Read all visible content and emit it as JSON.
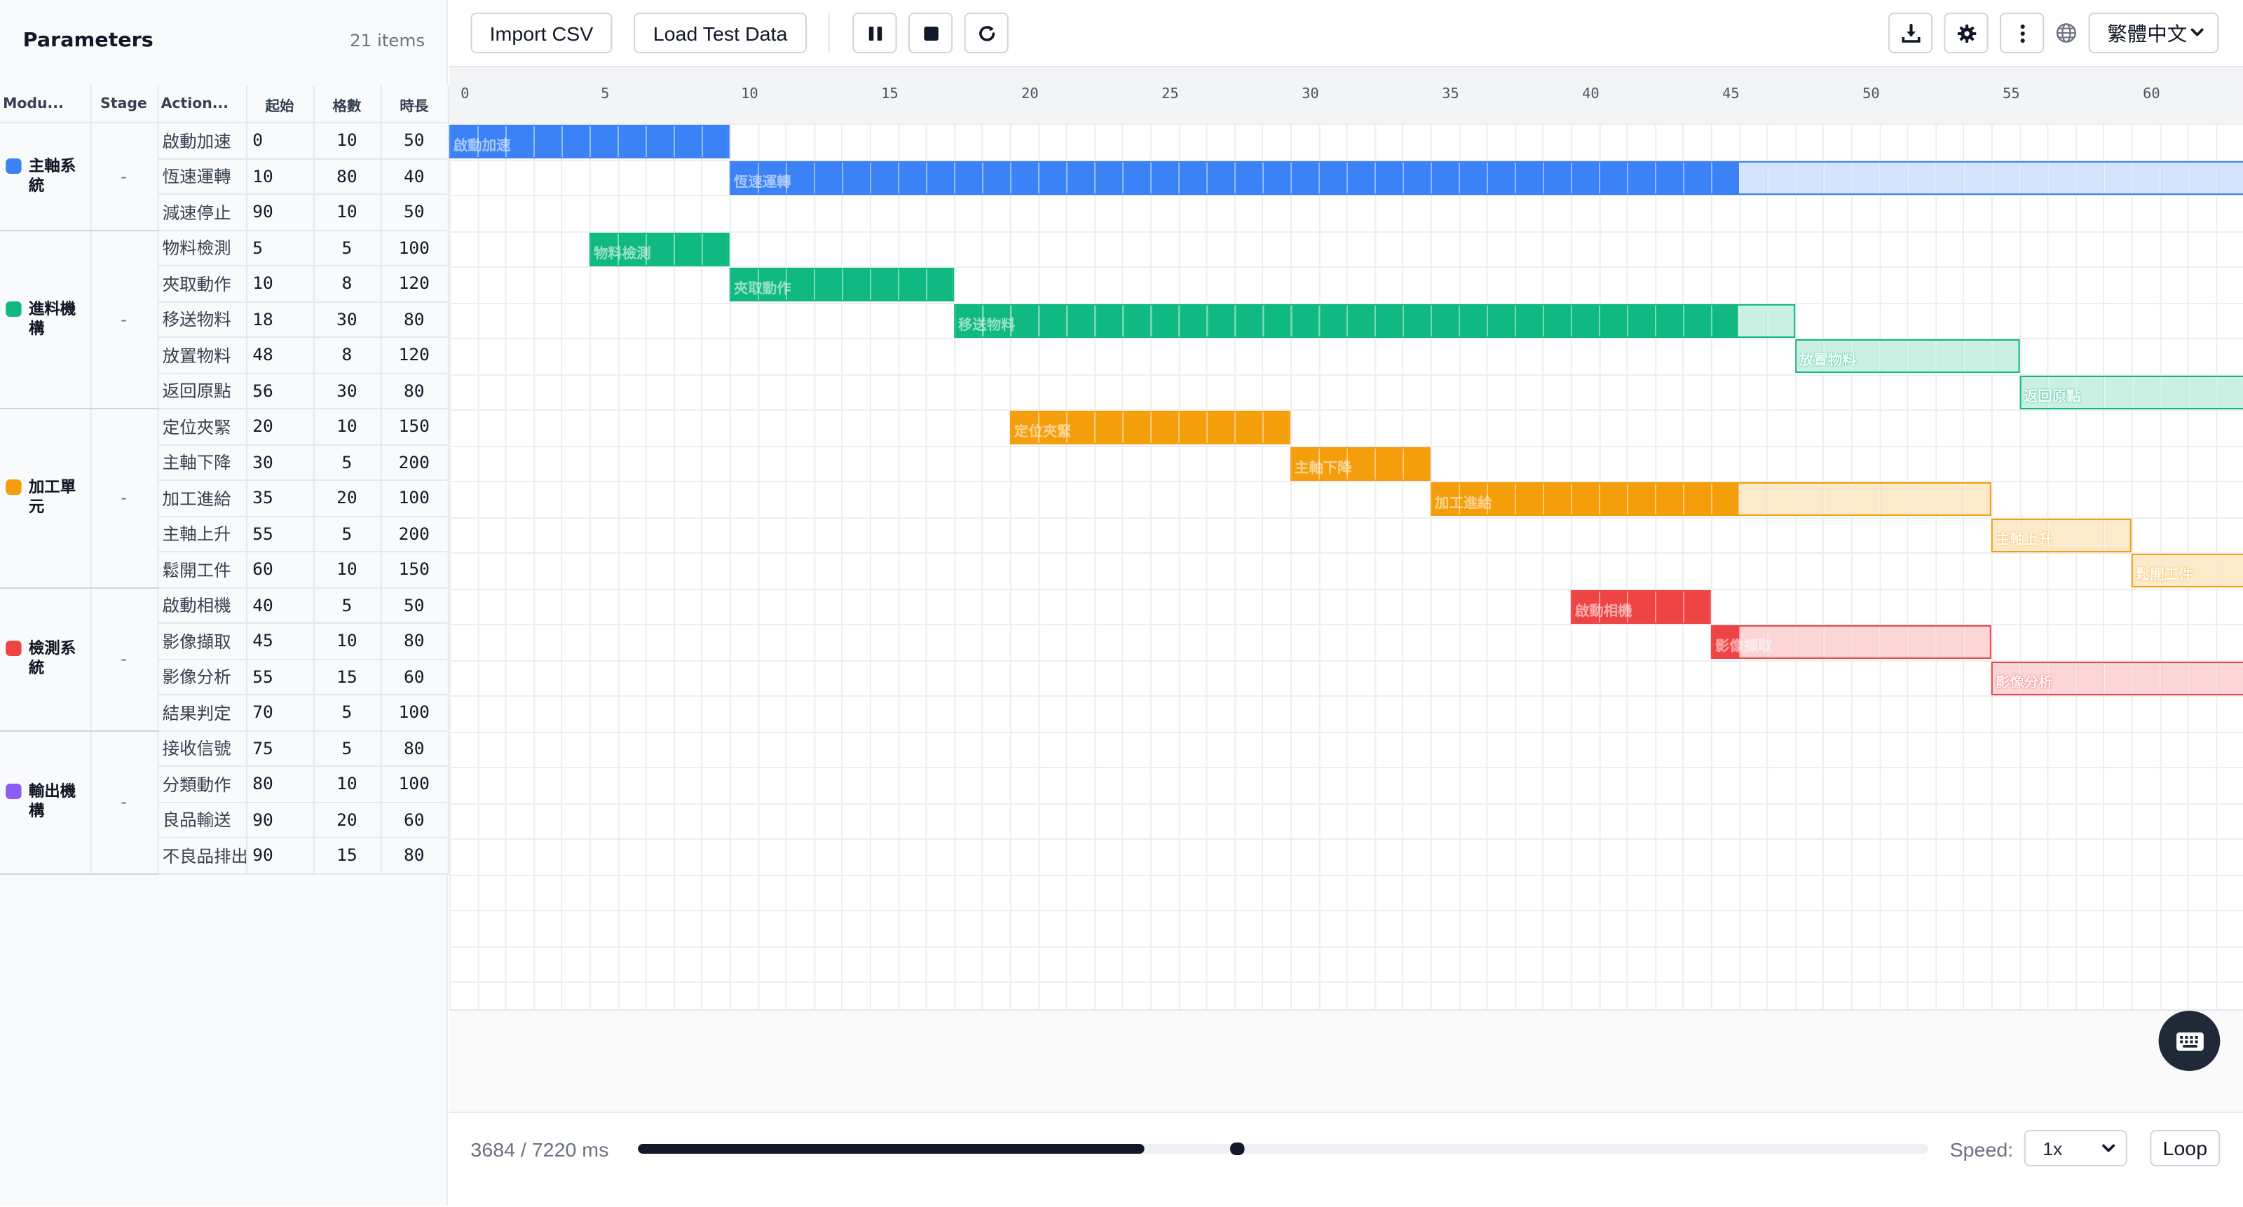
{
  "panel": {
    "title": "Parameters",
    "count": "21 items"
  },
  "table": {
    "headers": {
      "module": "Modu...",
      "stage": "Stage",
      "action": "Action...",
      "start": "起始",
      "cells": "格數",
      "duration": "時長"
    },
    "modules": [
      {
        "name": "主軸系統",
        "color": "#3b82f6",
        "stage": "-",
        "actions": [
          {
            "name": "啟動加速",
            "start": "0",
            "cells": "10",
            "duration": "50"
          },
          {
            "name": "恆速運轉",
            "start": "10",
            "cells": "80",
            "duration": "40"
          },
          {
            "name": "減速停止",
            "start": "90",
            "cells": "10",
            "duration": "50"
          }
        ]
      },
      {
        "name": "進料機構",
        "color": "#10b981",
        "stage": "-",
        "actions": [
          {
            "name": "物料檢測",
            "start": "5",
            "cells": "5",
            "duration": "100"
          },
          {
            "name": "夾取動作",
            "start": "10",
            "cells": "8",
            "duration": "120"
          },
          {
            "name": "移送物料",
            "start": "18",
            "cells": "30",
            "duration": "80"
          },
          {
            "name": "放置物料",
            "start": "48",
            "cells": "8",
            "duration": "120"
          },
          {
            "name": "返回原點",
            "start": "56",
            "cells": "30",
            "duration": "80"
          }
        ]
      },
      {
        "name": "加工單元",
        "color": "#f59e0b",
        "stage": "-",
        "actions": [
          {
            "name": "定位夾緊",
            "start": "20",
            "cells": "10",
            "duration": "150"
          },
          {
            "name": "主軸下降",
            "start": "30",
            "cells": "5",
            "duration": "200"
          },
          {
            "name": "加工進給",
            "start": "35",
            "cells": "20",
            "duration": "100"
          },
          {
            "name": "主軸上升",
            "start": "55",
            "cells": "5",
            "duration": "200"
          },
          {
            "name": "鬆開工件",
            "start": "60",
            "cells": "10",
            "duration": "150"
          }
        ]
      },
      {
        "name": "檢測系統",
        "color": "#ef4444",
        "stage": "-",
        "actions": [
          {
            "name": "啟動相機",
            "start": "40",
            "cells": "5",
            "duration": "50"
          },
          {
            "name": "影像擷取",
            "start": "45",
            "cells": "10",
            "duration": "80"
          },
          {
            "name": "影像分析",
            "start": "55",
            "cells": "15",
            "duration": "60"
          },
          {
            "name": "結果判定",
            "start": "70",
            "cells": "5",
            "duration": "100"
          }
        ]
      },
      {
        "name": "輸出機構",
        "color": "#8b5cf6",
        "stage": "-",
        "actions": [
          {
            "name": "接收信號",
            "start": "75",
            "cells": "5",
            "duration": "80"
          },
          {
            "name": "分類動作",
            "start": "80",
            "cells": "10",
            "duration": "100"
          },
          {
            "name": "良品輸送",
            "start": "90",
            "cells": "20",
            "duration": "60"
          },
          {
            "name": "不良品排出",
            "start": "90",
            "cells": "15",
            "duration": "80"
          }
        ]
      }
    ]
  },
  "toolbar": {
    "import_label": "Import CSV",
    "load_label": "Load Test Data",
    "language": "繁體中文",
    "icons": [
      "pause-icon",
      "stop-icon",
      "restart-icon",
      "download-icon",
      "gear-icon",
      "more-vertical-icon",
      "globe-icon"
    ]
  },
  "timeline": {
    "ruler_labels": [
      "0",
      "5",
      "10",
      "15",
      "20",
      "25",
      "30",
      "35",
      "40",
      "45",
      "50",
      "55",
      "60"
    ],
    "visible_units": 64,
    "row_count": 24,
    "playhead_unit": 46,
    "bars": [
      {
        "row": 0,
        "start": 0,
        "cells": 10,
        "label": "啟動加速",
        "color": "#3b82f6"
      },
      {
        "row": 1,
        "start": 10,
        "cells": 80,
        "label": "恆速運轉",
        "color": "#3b82f6"
      },
      {
        "row": 3,
        "start": 5,
        "cells": 5,
        "label": "物料檢測",
        "color": "#10b981"
      },
      {
        "row": 4,
        "start": 10,
        "cells": 8,
        "label": "夾取動作",
        "color": "#10b981"
      },
      {
        "row": 5,
        "start": 18,
        "cells": 30,
        "label": "移送物料",
        "color": "#10b981"
      },
      {
        "row": 6,
        "start": 48,
        "cells": 8,
        "label": "放置物料",
        "color": "#10b981"
      },
      {
        "row": 7,
        "start": 56,
        "cells": 30,
        "label": "返回原點",
        "color": "#10b981"
      },
      {
        "row": 8,
        "start": 20,
        "cells": 10,
        "label": "定位夾緊",
        "color": "#f59e0b"
      },
      {
        "row": 9,
        "start": 30,
        "cells": 5,
        "label": "主軸下降",
        "color": "#f59e0b"
      },
      {
        "row": 10,
        "start": 35,
        "cells": 20,
        "label": "加工進給",
        "color": "#f59e0b"
      },
      {
        "row": 11,
        "start": 55,
        "cells": 5,
        "label": "主軸上升",
        "color": "#f59e0b"
      },
      {
        "row": 12,
        "start": 60,
        "cells": 10,
        "label": "鬆開工件",
        "color": "#f59e0b"
      },
      {
        "row": 13,
        "start": 40,
        "cells": 5,
        "label": "啟動相機",
        "color": "#ef4444"
      },
      {
        "row": 14,
        "start": 45,
        "cells": 10,
        "label": "影像擷取",
        "color": "#ef4444"
      },
      {
        "row": 15,
        "start": 55,
        "cells": 15,
        "label": "影像分析",
        "color": "#ef4444"
      }
    ]
  },
  "playback": {
    "time_readout": "3684 / 7220 ms",
    "progress": 0.51,
    "thumb_position": 0.51,
    "speed_label": "Speed:",
    "speed_value": "1x",
    "loop_label": "Loop"
  }
}
